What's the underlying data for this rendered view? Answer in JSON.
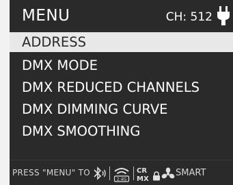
{
  "header": {
    "title": "MENU",
    "channel": "CH: 512",
    "power_icon": "plug-icon"
  },
  "menu": {
    "items": [
      {
        "label": "ADDRESS",
        "selected": true
      },
      {
        "label": "DMX MODE",
        "selected": false
      },
      {
        "label": "DMX REDUCED CHANNELS",
        "selected": false
      },
      {
        "label": "DMX DIMMING CURVE",
        "selected": false
      },
      {
        "label": "DMX SMOOTHING",
        "selected": false
      }
    ]
  },
  "footer": {
    "hint": "PRESS \"MENU\" TO",
    "band_label": "2.4G",
    "crmx_label": "CR",
    "mx_label": "MX",
    "smart": "SMART",
    "icons": [
      "bluetooth-icon",
      "wifi-icon",
      "crmx-icon",
      "lock-icon",
      "fan-icon"
    ]
  },
  "colors": {
    "screen_bg": "#2a2a2a",
    "selected_bg": "#e8e8e8",
    "text": "#ffffff"
  }
}
